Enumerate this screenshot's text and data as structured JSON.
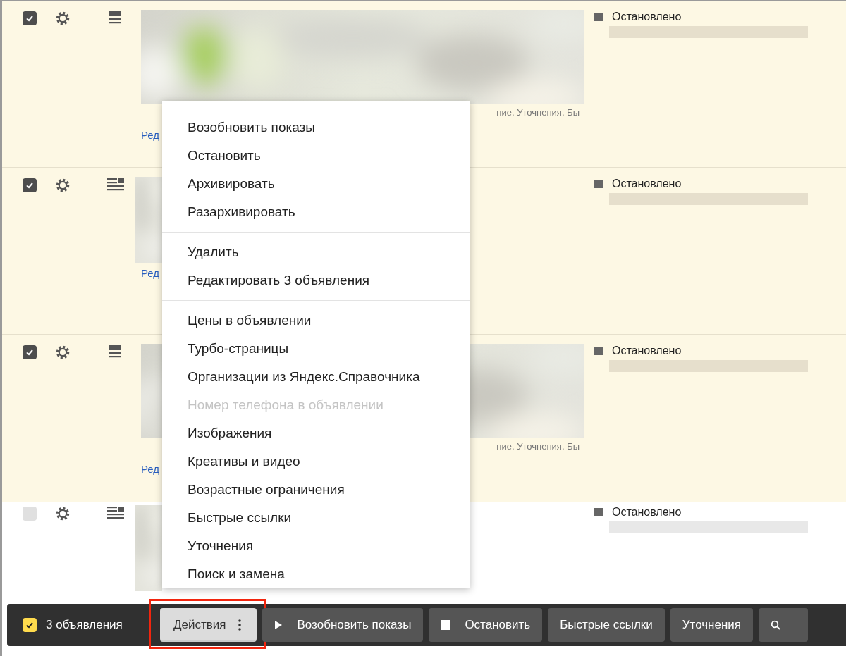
{
  "ads": [
    {
      "checked": true,
      "kind": "wide",
      "snippet": "ние. Уточнения. Бы",
      "edit_link": "Ред",
      "status": "Остановлено"
    },
    {
      "checked": true,
      "kind": "narrow",
      "edit_link": "Ред",
      "status": "Остановлено"
    },
    {
      "checked": true,
      "kind": "wide",
      "snippet": "ние. Уточнения. Бы",
      "edit_link": "Ред",
      "status": "Остановлено"
    },
    {
      "checked": false,
      "kind": "narrow",
      "status": "Остановлено"
    }
  ],
  "menu": {
    "groups": [
      [
        {
          "label": "Возобновить показы",
          "disabled": false
        },
        {
          "label": "Остановить",
          "disabled": false
        },
        {
          "label": "Архивировать",
          "disabled": false
        },
        {
          "label": "Разархивировать",
          "disabled": false
        }
      ],
      [
        {
          "label": "Удалить",
          "disabled": false
        },
        {
          "label": "Редактировать 3 объявления",
          "disabled": false
        }
      ],
      [
        {
          "label": "Цены в объявлении",
          "disabled": false
        },
        {
          "label": "Турбо-страницы",
          "disabled": false
        },
        {
          "label": "Организации из Яндекс.Справочника",
          "disabled": false
        },
        {
          "label": "Номер телефона в объявлении",
          "disabled": true
        },
        {
          "label": "Изображения",
          "disabled": false
        },
        {
          "label": "Креативы и видео",
          "disabled": false
        },
        {
          "label": "Возрастные ограничения",
          "disabled": false
        },
        {
          "label": "Быстрые ссылки",
          "disabled": false
        },
        {
          "label": "Уточнения",
          "disabled": false
        },
        {
          "label": "Поиск и замена",
          "disabled": false
        }
      ]
    ]
  },
  "action_bar": {
    "checked": true,
    "count": "3 объявления",
    "buttons": [
      {
        "kind": "menu",
        "label": "Действия",
        "highlighted": true
      },
      {
        "kind": "play",
        "label": "Возобновить показы"
      },
      {
        "kind": "stop",
        "label": "Остановить"
      },
      {
        "kind": "plain",
        "label": "Быстрые ссылки"
      },
      {
        "kind": "plain",
        "label": "Уточнения"
      },
      {
        "kind": "search"
      }
    ]
  }
}
